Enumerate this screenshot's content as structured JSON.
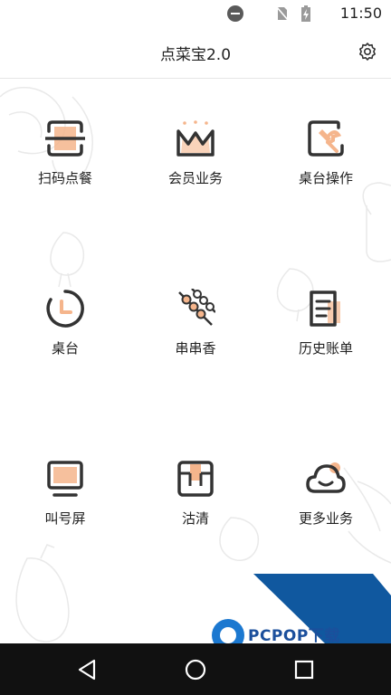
{
  "status_bar": {
    "time": "11:50",
    "icons": [
      "do-not-disturb-icon",
      "no-sim-icon",
      "battery-charging-icon"
    ]
  },
  "header": {
    "title": "点菜宝2.0",
    "settings_icon": "gear-icon"
  },
  "menu": {
    "accent_color": "#f5b58c",
    "stroke_color": "#333333",
    "items": [
      {
        "label": "扫码点餐",
        "icon": "scan-icon"
      },
      {
        "label": "会员业务",
        "icon": "crown-icon"
      },
      {
        "label": "桌台操作",
        "icon": "wrench-icon"
      },
      {
        "label": "桌台",
        "icon": "clock-icon"
      },
      {
        "label": "串串香",
        "icon": "skewer-icon"
      },
      {
        "label": "历史账单",
        "icon": "bill-icon"
      },
      {
        "label": "叫号屏",
        "icon": "monitor-icon"
      },
      {
        "label": "沽清",
        "icon": "box-icon"
      },
      {
        "label": "更多业务",
        "icon": "cloud-icon"
      }
    ]
  },
  "watermark": {
    "text": "PCPOP下载"
  },
  "nav_bar": {
    "buttons": [
      "back-icon",
      "home-icon",
      "recents-icon"
    ]
  }
}
